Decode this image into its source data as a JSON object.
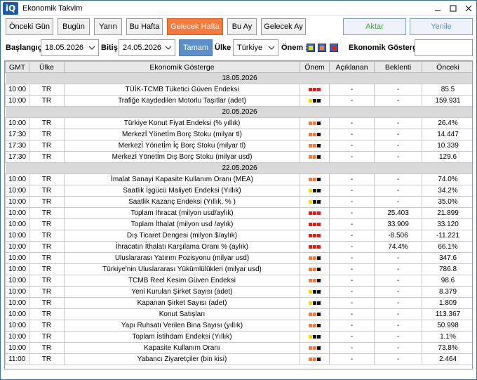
{
  "window": {
    "title": "Ekonomik Takvim",
    "logo": "iQ"
  },
  "toolbar": {
    "buttons": [
      "Önceki Gün",
      "Bugün",
      "Yarın",
      "Bu Hafta",
      "Gelecek Hafta",
      "Bu Ay",
      "Gelecek Ay"
    ],
    "active": "Gelecek Hafta",
    "aktar": "Aktar",
    "yenile": "Yenile"
  },
  "filters": {
    "start_label": "Başlangıç :",
    "start_value": "18.05.2026",
    "end_label": "Bitiş :",
    "end_value": "24.05.2026",
    "ok_label": "Tamam",
    "country_label": "Ülke :",
    "country_value": "Türkiye",
    "importance_label": "Önem :",
    "importance_colors": [
      "#f5d800",
      "#f47a3d",
      "#e01e1e"
    ],
    "indicator_label": "Ekonomik Gösterge :",
    "indicator_value": ""
  },
  "colors": {
    "high": "#e01e1e",
    "medium": "#f47a3d",
    "low": "#f5d800",
    "empty": "#111111",
    "accent": "#f47a3d"
  },
  "table": {
    "headers": [
      "GMT",
      "Ülke",
      "Ekonomik Gösterge",
      "Önem",
      "Açıklanan",
      "Beklenti",
      "Önceki"
    ],
    "groups": [
      {
        "date": "18.05.2026",
        "rows": [
          {
            "gmt": "10:00",
            "country": "TR",
            "name": "TÜİK-TCMB Tüketici Güven Endeksi",
            "imp": "high",
            "actual": "-",
            "forecast": "-",
            "previous": "85.5"
          },
          {
            "gmt": "10:00",
            "country": "TR",
            "name": "Trafiğe Kaydedilen Motorlu Taşıtlar (adet)",
            "imp": "low",
            "actual": "-",
            "forecast": "-",
            "previous": "159.931"
          }
        ]
      },
      {
        "date": "20.05.2026",
        "rows": [
          {
            "gmt": "10:00",
            "country": "TR",
            "name": "Türkiye Konut Fiyat Endeksi (% yıllık)",
            "imp": "medium",
            "actual": "-",
            "forecast": "-",
            "previous": "26.4%"
          },
          {
            "gmt": "17:30",
            "country": "TR",
            "name": "Merkezİ Yönetİm Borç Stoku (milyar tl)",
            "imp": "medium",
            "actual": "-",
            "forecast": "-",
            "previous": "14.447"
          },
          {
            "gmt": "17:30",
            "country": "TR",
            "name": "Merkezİ Yönetİm İç Borç Stoku (milyar tl)",
            "imp": "medium",
            "actual": "-",
            "forecast": "-",
            "previous": "10.339"
          },
          {
            "gmt": "17:30",
            "country": "TR",
            "name": "Merkezİ Yönetİm Dış Borç Stoku (milyar usd)",
            "imp": "medium",
            "actual": "-",
            "forecast": "-",
            "previous": "129.6"
          }
        ]
      },
      {
        "date": "22.05.2026",
        "rows": [
          {
            "gmt": "10:00",
            "country": "TR",
            "name": "İmalat Sanayi Kapasite Kullanım Oranı (MEA)",
            "imp": "medium",
            "actual": "-",
            "forecast": "-",
            "previous": "74.0%"
          },
          {
            "gmt": "10:00",
            "country": "TR",
            "name": "Saatlik İşgücü Maliyeti Endeksi (Yıllık)",
            "imp": "low",
            "actual": "-",
            "forecast": "-",
            "previous": "34.2%"
          },
          {
            "gmt": "10:00",
            "country": "TR",
            "name": "Saatlik Kazanç Endeksi (Yıllık, % )",
            "imp": "low",
            "actual": "-",
            "forecast": "-",
            "previous": "35.0%"
          },
          {
            "gmt": "10:00",
            "country": "TR",
            "name": "Toplam İhracat (milyon usd/aylık)",
            "imp": "high",
            "actual": "-",
            "forecast": "25.403",
            "previous": "21.899"
          },
          {
            "gmt": "10:00",
            "country": "TR",
            "name": "Toplam İthalat (milyon usd /aylık)",
            "imp": "high",
            "actual": "-",
            "forecast": "33.909",
            "previous": "33.120"
          },
          {
            "gmt": "10:00",
            "country": "TR",
            "name": "Dış Ticaret Dengesi (milyon $/aylık)",
            "imp": "high",
            "actual": "-",
            "forecast": "-8.506",
            "previous": "-11.221"
          },
          {
            "gmt": "10:00",
            "country": "TR",
            "name": "İhracatın İthalatı Karşılama Oranı % (aylık)",
            "imp": "high",
            "actual": "-",
            "forecast": "74.4%",
            "previous": "66.1%"
          },
          {
            "gmt": "10:00",
            "country": "TR",
            "name": "Uluslararası Yatırım Pozisyonu (milyar usd)",
            "imp": "medium",
            "actual": "-",
            "forecast": "-",
            "previous": "347.6"
          },
          {
            "gmt": "10:00",
            "country": "TR",
            "name": "Türkiye'nin Uluslararası Yükümlülükleri (milyar usd)",
            "imp": "medium",
            "actual": "-",
            "forecast": "-",
            "previous": "786.8"
          },
          {
            "gmt": "10:00",
            "country": "TR",
            "name": "TCMB Reel Kesim Güven Endeksi",
            "imp": "medium",
            "actual": "-",
            "forecast": "-",
            "previous": "98.6"
          },
          {
            "gmt": "10:00",
            "country": "TR",
            "name": "Yeni Kurulan Şirket Sayısı (adet)",
            "imp": "low",
            "actual": "-",
            "forecast": "-",
            "previous": "8.379"
          },
          {
            "gmt": "10:00",
            "country": "TR",
            "name": "Kapanan Şirket Sayısı (adet)",
            "imp": "low",
            "actual": "-",
            "forecast": "-",
            "previous": "1.809"
          },
          {
            "gmt": "10:00",
            "country": "TR",
            "name": "Konut Satışları",
            "imp": "medium",
            "actual": "-",
            "forecast": "-",
            "previous": "113.367"
          },
          {
            "gmt": "10:00",
            "country": "TR",
            "name": "Yapı Ruhsatı Verilen Bina Sayısı (yıllık)",
            "imp": "medium",
            "actual": "-",
            "forecast": "-",
            "previous": "50.998"
          },
          {
            "gmt": "10:00",
            "country": "TR",
            "name": "Toplam İstihdam Endeksi (Yıllık)",
            "imp": "low",
            "actual": "-",
            "forecast": "-",
            "previous": "1.1%"
          },
          {
            "gmt": "10:00",
            "country": "TR",
            "name": "Kapasite Kullanım Oranı",
            "imp": "medium",
            "actual": "-",
            "forecast": "-",
            "previous": "73.8%"
          },
          {
            "gmt": "11:00",
            "country": "TR",
            "name": "Yabancı Ziyaretçiler (bin kisi)",
            "imp": "medium",
            "actual": "-",
            "forecast": "-",
            "previous": "2.464"
          }
        ]
      }
    ]
  }
}
